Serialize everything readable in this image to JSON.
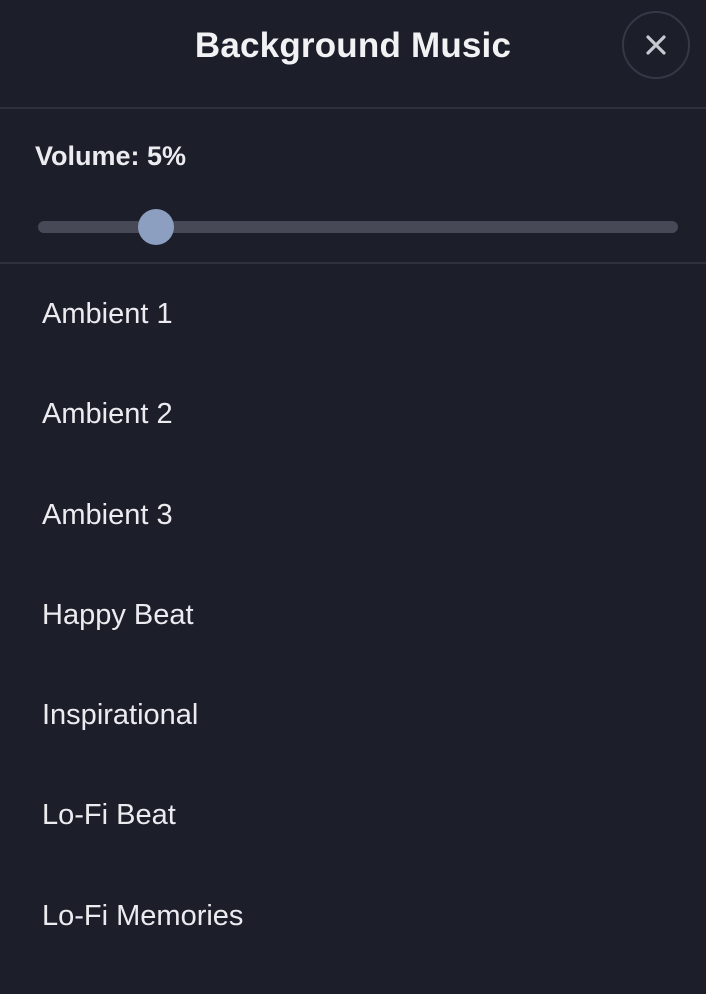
{
  "header": {
    "title": "Background Music",
    "close_icon": "close-icon"
  },
  "volume": {
    "label": "Volume: 5%",
    "value_fraction": 0.185
  },
  "tracks": [
    {
      "label": "Ambient 1"
    },
    {
      "label": "Ambient 2"
    },
    {
      "label": "Ambient 3"
    },
    {
      "label": "Happy Beat"
    },
    {
      "label": "Inspirational"
    },
    {
      "label": "Lo-Fi Beat"
    },
    {
      "label": "Lo-Fi Memories"
    }
  ],
  "colors": {
    "background": "#1c1e2a",
    "divider": "#2e313d",
    "slider_track": "#474a56",
    "slider_thumb": "#8d9fc1",
    "text": "#ececf0"
  }
}
